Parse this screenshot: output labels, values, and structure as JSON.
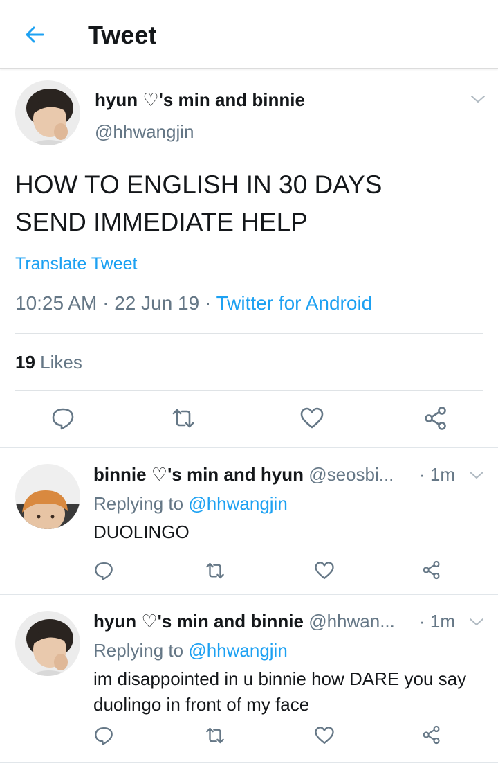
{
  "header": {
    "title": "Tweet",
    "back_icon": "arrow-left-icon",
    "accent": "#1da1f2"
  },
  "main_tweet": {
    "display_name": "hyun ♡'s min and binnie",
    "handle": "@hhwangjin",
    "text_line1": "HOW TO ENGLISH IN 30 DAYS",
    "text_line2": "SEND IMMEDIATE HELP",
    "translate_label": "Translate Tweet",
    "time": "10:25 AM",
    "date": "22 Jun 19",
    "source": "Twitter for Android",
    "dot": " · ",
    "likes_count": "19",
    "likes_label": "Likes"
  },
  "replies": [
    {
      "display_name": "binnie ♡'s min and hyun",
      "handle": "@seosbi...",
      "time": "· 1m",
      "replying_prefix": "Replying to",
      "replying_to": "@hhwangjin",
      "text": "DUOLINGO"
    },
    {
      "display_name": "hyun ♡'s min and binnie",
      "handle": "@hhwan...",
      "time": "· 1m",
      "replying_prefix": "Replying to",
      "replying_to": "@hhwangjin",
      "text": "im disappointed in u binnie how DARE you say duolingo in front of my face"
    }
  ],
  "icons": [
    "reply-icon",
    "retweet-icon",
    "like-icon",
    "share-icon",
    "chevron-down-icon"
  ],
  "colors": {
    "primary_text": "#14171a",
    "secondary_text": "#657786",
    "link": "#1da1f2",
    "divider": "#e1e6ea"
  }
}
